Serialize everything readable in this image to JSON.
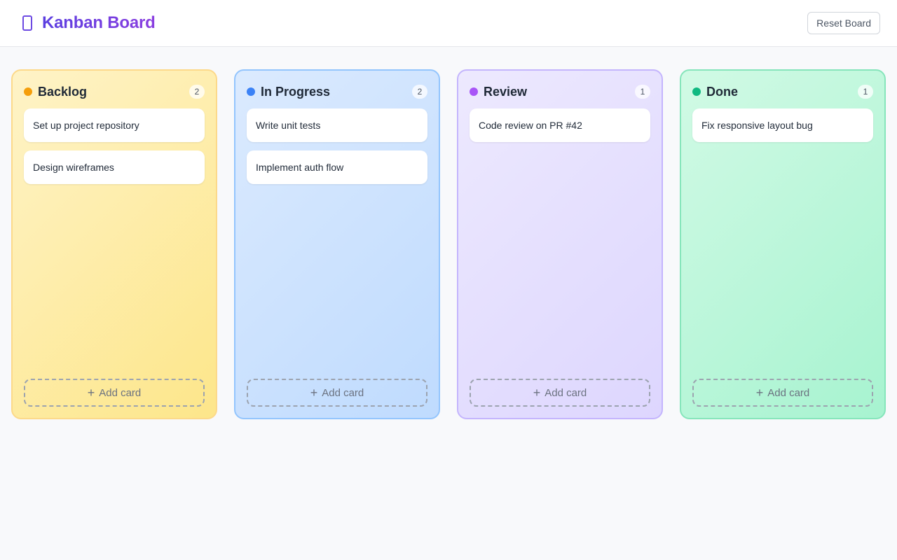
{
  "app": {
    "title": "Kanban Board",
    "icon": "phone-icon",
    "reset_label": "Reset Board"
  },
  "columns": [
    {
      "title": "Backlog",
      "count": "2",
      "dot_color": "#f59e0b",
      "cards": [
        "Set up project repository",
        "Design wireframes"
      ],
      "add_label": "Add card"
    },
    {
      "title": "In Progress",
      "count": "2",
      "dot_color": "#3b82f6",
      "cards": [
        "Write unit tests",
        "Implement auth flow"
      ],
      "add_label": "Add card"
    },
    {
      "title": "Review",
      "count": "1",
      "dot_color": "#a855f7",
      "cards": [
        "Code review on PR #42"
      ],
      "add_label": "Add card"
    },
    {
      "title": "Done",
      "count": "1",
      "dot_color": "#10b981",
      "cards": [
        "Fix responsive layout bug"
      ],
      "add_label": "Add card"
    }
  ],
  "colors": {
    "brand": "#6d4ae2",
    "backlog_bg": "#fef3c7",
    "progress_bg": "#dbeafe",
    "review_bg": "#ede9fe",
    "done_bg": "#d1fae5"
  }
}
